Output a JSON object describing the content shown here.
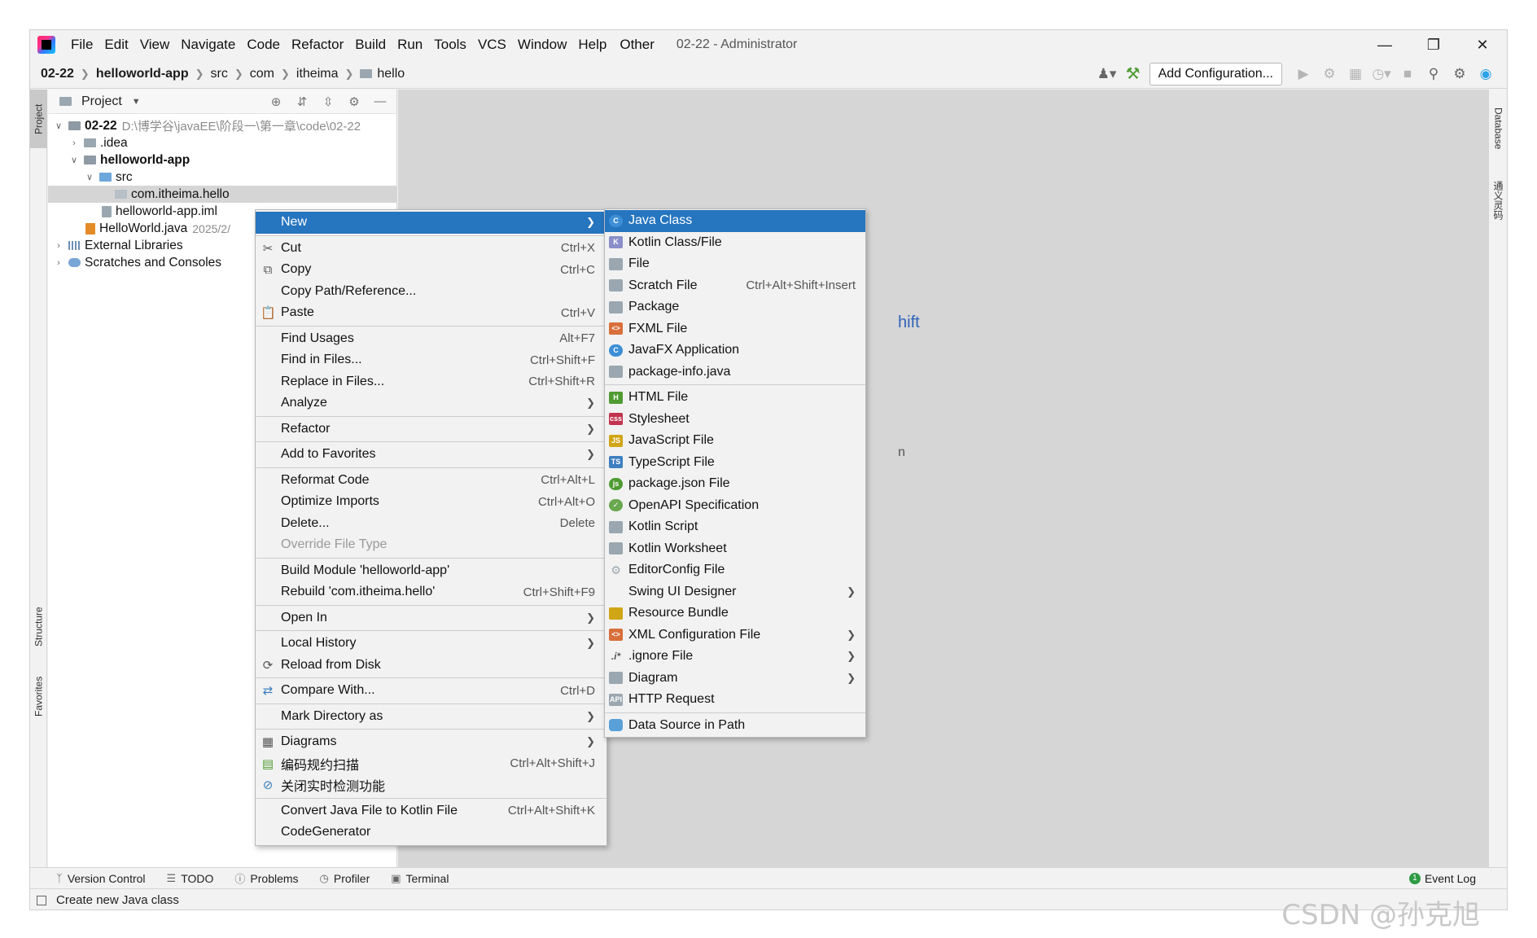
{
  "menubar": {
    "items": [
      "File",
      "Edit",
      "View",
      "Navigate",
      "Code",
      "Refactor",
      "Build",
      "Run",
      "Tools",
      "VCS",
      "Window",
      "Help",
      "Other"
    ],
    "window_title": "02-22 - Administrator"
  },
  "breadcrumb": {
    "project": "02-22",
    "module": "helloworld-app",
    "src": "src",
    "com": "com",
    "itheima": "itheima",
    "hello": "hello"
  },
  "navbar": {
    "add_configuration": "Add Configuration..."
  },
  "stripes": {
    "project": "Project",
    "structure": "Structure",
    "favorites": "Favorites",
    "database": "Database",
    "plugin": "通义灵码"
  },
  "project_panel": {
    "title": "Project",
    "tree": [
      {
        "label": "02-22",
        "path": "D:\\博学谷\\javaEE\\阶段一\\第一章\\code\\02-22"
      },
      {
        "label": ".idea"
      },
      {
        "label": "helloworld-app"
      },
      {
        "label": "src"
      },
      {
        "label": "com.itheima.hello"
      },
      {
        "label": "helloworld-app.iml"
      },
      {
        "label": "HelloWorld.java",
        "date": "2025/2/"
      },
      {
        "label": "External Libraries"
      },
      {
        "label": "Scratches and Consoles"
      }
    ]
  },
  "editor": {
    "hint_1": "hift",
    "hint_2": "n"
  },
  "context_menu": {
    "items": [
      {
        "label": "New",
        "submenu": true
      },
      {
        "label": "Cut",
        "shortcut": "Ctrl+X"
      },
      {
        "label": "Copy",
        "shortcut": "Ctrl+C"
      },
      {
        "label": "Copy Path/Reference..."
      },
      {
        "label": "Paste",
        "shortcut": "Ctrl+V"
      },
      {
        "label": "Find Usages",
        "shortcut": "Alt+F7"
      },
      {
        "label": "Find in Files...",
        "shortcut": "Ctrl+Shift+F"
      },
      {
        "label": "Replace in Files...",
        "shortcut": "Ctrl+Shift+R"
      },
      {
        "label": "Analyze",
        "submenu": true
      },
      {
        "label": "Refactor",
        "submenu": true
      },
      {
        "label": "Add to Favorites",
        "submenu": true
      },
      {
        "label": "Reformat Code",
        "shortcut": "Ctrl+Alt+L"
      },
      {
        "label": "Optimize Imports",
        "shortcut": "Ctrl+Alt+O"
      },
      {
        "label": "Delete...",
        "shortcut": "Delete"
      },
      {
        "label": "Override File Type"
      },
      {
        "label": "Build Module 'helloworld-app'"
      },
      {
        "label": "Rebuild 'com.itheima.hello'",
        "shortcut": "Ctrl+Shift+F9"
      },
      {
        "label": "Open In",
        "submenu": true
      },
      {
        "label": "Local History",
        "submenu": true
      },
      {
        "label": "Reload from Disk"
      },
      {
        "label": "Compare With...",
        "shortcut": "Ctrl+D"
      },
      {
        "label": "Mark Directory as",
        "submenu": true
      },
      {
        "label": "Diagrams",
        "submenu": true
      },
      {
        "label": "编码规约扫描",
        "shortcut": "Ctrl+Alt+Shift+J"
      },
      {
        "label": "关闭实时检测功能"
      },
      {
        "label": "Convert Java File to Kotlin File",
        "shortcut": "Ctrl+Alt+Shift+K"
      },
      {
        "label": "CodeGenerator"
      }
    ]
  },
  "new_submenu": {
    "items": [
      {
        "label": "Java Class",
        "icon": "java-class-icon",
        "color": "#3d8ed6"
      },
      {
        "label": "Kotlin Class/File",
        "icon": "kotlin-icon",
        "color": "#8a8fc9"
      },
      {
        "label": "File",
        "icon": "file-icon",
        "color": "#9aa7b0"
      },
      {
        "label": "Scratch File",
        "shortcut": "Ctrl+Alt+Shift+Insert",
        "icon": "scratch-icon",
        "color": "#9aa7b0"
      },
      {
        "label": "Package",
        "icon": "package-icon",
        "color": "#9aa7b0"
      },
      {
        "label": "FXML File",
        "icon": "fxml-icon",
        "color": "#d96f3b"
      },
      {
        "label": "JavaFX Application",
        "icon": "javafx-icon",
        "color": "#3d8ed6"
      },
      {
        "label": "package-info.java",
        "icon": "package-info-icon",
        "color": "#9aa7b0"
      },
      {
        "label": "HTML File",
        "icon": "html-icon",
        "color": "#4f9b32"
      },
      {
        "label": "Stylesheet",
        "icon": "css-icon",
        "color": "#c2344d"
      },
      {
        "label": "JavaScript File",
        "icon": "js-icon",
        "color": "#d0a516"
      },
      {
        "label": "TypeScript File",
        "icon": "ts-icon",
        "color": "#3d7fc0"
      },
      {
        "label": "package.json File",
        "icon": "npm-icon",
        "color": "#4f9b32"
      },
      {
        "label": "OpenAPI Specification",
        "icon": "openapi-icon",
        "color": "#6aa84f"
      },
      {
        "label": "Kotlin Script",
        "icon": "kotlin-script-icon",
        "color": "#9aa7b0"
      },
      {
        "label": "Kotlin Worksheet",
        "icon": "kotlin-worksheet-icon",
        "color": "#9aa7b0"
      },
      {
        "label": "EditorConfig File",
        "icon": "gear-icon",
        "color": "#9aa7b0"
      },
      {
        "label": "Swing UI Designer",
        "submenu": true
      },
      {
        "label": "Resource Bundle",
        "icon": "resource-bundle-icon",
        "color": "#d0a516"
      },
      {
        "label": "XML Configuration File",
        "submenu": true,
        "icon": "xml-icon",
        "color": "#d96f3b"
      },
      {
        "label": ".ignore File",
        "submenu": true,
        "icon": "ignore-icon",
        "color": "#555555"
      },
      {
        "label": "Diagram",
        "submenu": true,
        "icon": "diagram-icon",
        "color": "#9aa7b0"
      },
      {
        "label": "HTTP Request",
        "icon": "http-request-icon",
        "color": "#9aa7b0"
      },
      {
        "label": "Data Source in Path",
        "icon": "database-icon",
        "color": "#5aa0d8"
      }
    ]
  },
  "bottom_bar": {
    "tabs": [
      "Version Control",
      "TODO",
      "Problems",
      "Profiler",
      "Terminal"
    ],
    "event_log": "Event Log"
  },
  "status": {
    "text": "Create new Java class"
  },
  "watermark": "CSDN @孙克旭"
}
